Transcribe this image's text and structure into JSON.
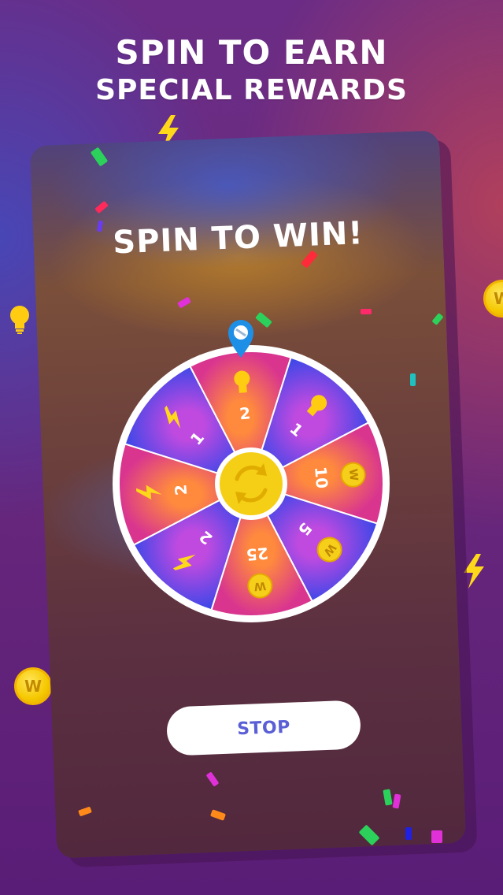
{
  "header": {
    "line1": "SPIN TO EARN",
    "line2": "SPECIAL REWARDS"
  },
  "card": {
    "title": "SPIN TO WIN!"
  },
  "wheel": {
    "segments": [
      {
        "icon": "lightbulb-icon",
        "value": "2"
      },
      {
        "icon": "lightbulb-icon",
        "value": "1"
      },
      {
        "icon": "coin-icon",
        "value": "10"
      },
      {
        "icon": "coin-icon",
        "value": "5"
      },
      {
        "icon": "coin-icon",
        "value": "25"
      },
      {
        "icon": "lightning-icon",
        "value": "2"
      },
      {
        "icon": "lightning-icon",
        "value": "2"
      },
      {
        "icon": "lightning-icon",
        "value": "1"
      }
    ],
    "coin_letter": "W"
  },
  "stop_button": {
    "label": "STOP"
  },
  "colors": {
    "segment_pink": "#e2479a",
    "segment_blue": "#4a48e6",
    "segment_orange": "#ff7a4a",
    "hub": "#f7d21b",
    "pointer": "#1e8fe6",
    "stop_text": "#5a5fd6"
  }
}
